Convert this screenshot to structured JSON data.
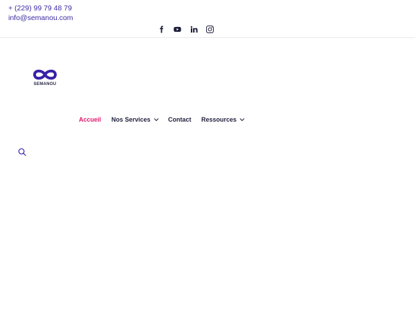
{
  "topbar": {
    "phone": "+ (229) 99 79 48 79",
    "email": "info@semanou.com",
    "social": [
      {
        "icon": "facebook-icon"
      },
      {
        "icon": "youtube-icon"
      },
      {
        "icon": "linkedin-icon"
      },
      {
        "icon": "instagram-icon"
      }
    ]
  },
  "brand": {
    "name": "SEMANOU",
    "logo_color": "#3a1fa8"
  },
  "nav": {
    "active_color": "#e0186c",
    "items": [
      {
        "label": "Accueil",
        "active": true,
        "has_dropdown": false
      },
      {
        "label": "Nos Services",
        "active": false,
        "has_dropdown": true
      },
      {
        "label": "Contact",
        "active": false,
        "has_dropdown": false
      },
      {
        "label": "Ressources",
        "active": false,
        "has_dropdown": true
      }
    ]
  },
  "search": {
    "icon": "search-icon",
    "color": "#3a1fa8"
  }
}
